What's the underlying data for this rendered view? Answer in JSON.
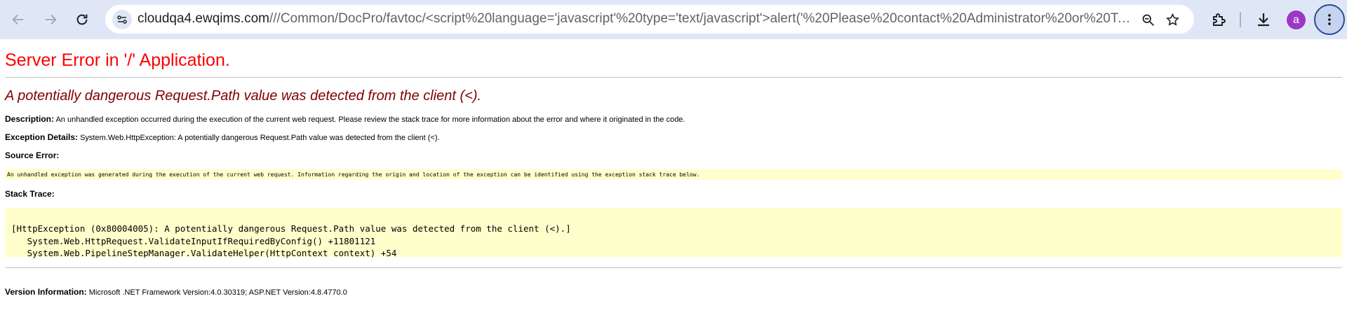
{
  "browser": {
    "url_host": "cloudqa4.ewqims.com",
    "url_path": "///Common/DocPro/favtoc/<script%20language='javascript'%20type='text/javascript'>alert('%20Please%20contact%20Administrator%20or%20Technical%20S...",
    "profile_initial": "a",
    "icons": [
      "back-arrow-icon",
      "forward-arrow-icon",
      "reload-icon",
      "site-info-icon",
      "zoom-icon",
      "star-icon",
      "extensions-icon",
      "download-icon",
      "kebab-menu-icon"
    ]
  },
  "error_page": {
    "title": "Server Error in '/' Application.",
    "subtitle": "A potentially dangerous Request.Path value was detected from the client (<).",
    "description_label": "Description:",
    "description_text": " An unhandled exception occurred during the execution of the current web request. Please review the stack trace for more information about the error and where it originated in the code.",
    "exception_label": "Exception Details:",
    "exception_text": " System.Web.HttpException: A potentially dangerous Request.Path value was detected from the client (<).",
    "source_error_label": "Source Error:",
    "source_error_text": "An unhandled exception was generated during the execution of the current web request. Information regarding the origin and location of the exception can be identified using the exception stack trace below.",
    "stack_trace_label": "Stack Trace:",
    "stack_trace": "[HttpException (0x80004005): A potentially dangerous Request.Path value was detected from the client (<).]\n   System.Web.HttpRequest.ValidateInputIfRequiredByConfig() +11801121\n   System.Web.PipelineStepManager.ValidateHelper(HttpContext context) +54",
    "version_label": "Version Information:",
    "version_text": " Microsoft .NET Framework Version:4.0.30319; ASP.NET Version:4.8.4770.0"
  },
  "colors": {
    "title_red": "#ff0000",
    "subtitle_maroon": "#800000",
    "code_background": "#ffffcc",
    "chrome_bar": "#dfe7f7"
  }
}
